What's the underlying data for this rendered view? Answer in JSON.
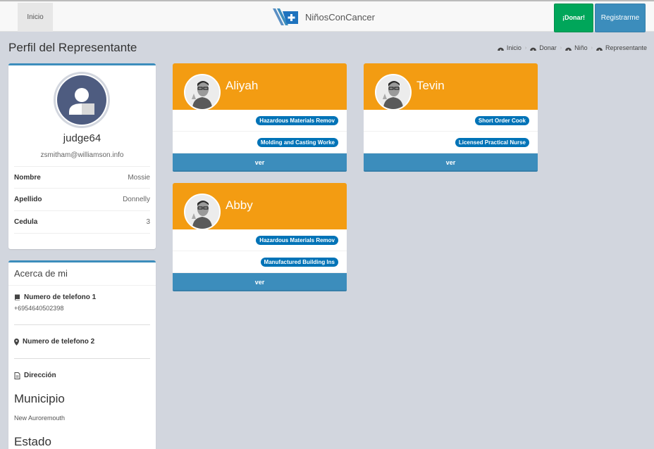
{
  "nav": {
    "home_label": "Inicio",
    "brand_name": "NiñosConCancer",
    "donate_label": "¡Donar!",
    "register_label": "Registrarme"
  },
  "page": {
    "title": "Perfil del Representante",
    "breadcrumb": [
      "Inicio",
      "Donar",
      "Niño",
      "Representante"
    ]
  },
  "profile": {
    "username": "judge64",
    "email": "zsmitham@williamson.info",
    "fields": [
      {
        "label": "Nombre",
        "value": "Mossie"
      },
      {
        "label": "Apellido",
        "value": "Donnelly"
      },
      {
        "label": "Cedula",
        "value": "3"
      }
    ]
  },
  "about": {
    "title": "Acerca de mi",
    "phone1_label": "Numero de telefono 1",
    "phone1_value": "+6954640502398",
    "phone2_label": "Numero de telefono 2",
    "address_label": "Dirección",
    "municipio_label": "Municipio",
    "municipio_value": "New Auroremouth",
    "estado_label": "Estado"
  },
  "children": [
    {
      "name": "Aliyah",
      "jobs": [
        "Hazardous Materials Remov",
        "Molding and Casting Worke"
      ],
      "button": "ver"
    },
    {
      "name": "Tevin",
      "jobs": [
        "Short Order Cook",
        "Licensed Practical Nurse"
      ],
      "button": "ver"
    },
    {
      "name": "Abby",
      "jobs": [
        "Hazardous Materials Remov",
        "Manufactured Building Ins"
      ],
      "button": "ver"
    }
  ],
  "colors": {
    "card_header": "#f39c12",
    "primary": "#3c8dbc",
    "success": "#00a65a",
    "badge": "#0073b7",
    "background": "#d2d6de"
  }
}
